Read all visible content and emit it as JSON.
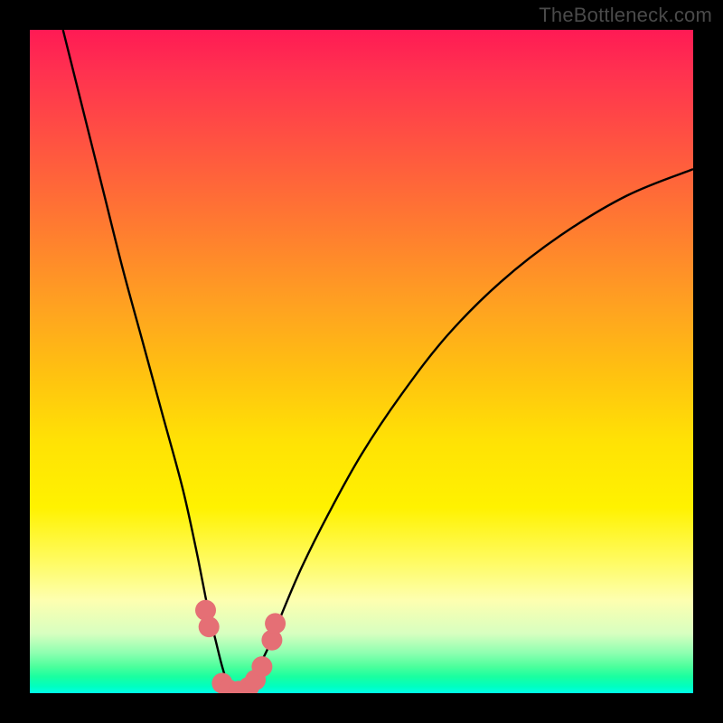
{
  "attribution": "TheBottleneck.com",
  "colors": {
    "frame": "#000000",
    "curve_stroke": "#000000",
    "marker_fill": "#e56f75",
    "marker_stroke": "#cc5a60"
  },
  "chart_data": {
    "type": "line",
    "title": "",
    "xlabel": "",
    "ylabel": "",
    "xlim": [
      0,
      100
    ],
    "ylim": [
      0,
      100
    ],
    "background_gradient": {
      "top": "#ff1a54",
      "mid": "#ffe205",
      "bottom": "#00ffe8",
      "meaning": "red-high to green-low bottleneck severity"
    },
    "series": [
      {
        "name": "bottleneck-curve",
        "x": [
          5,
          8,
          11,
          14,
          17,
          20,
          23,
          25,
          26,
          27,
          28,
          29,
          30,
          31,
          32,
          33,
          34,
          36,
          38,
          41,
          45,
          50,
          56,
          63,
          71,
          80,
          90,
          100
        ],
        "y": [
          100,
          88,
          76,
          64,
          53,
          42,
          31,
          22,
          17,
          12,
          8,
          4,
          1,
          0,
          0,
          1,
          3,
          7,
          12,
          19,
          27,
          36,
          45,
          54,
          62,
          69,
          75,
          79
        ],
        "note": "y is bottleneck percentage; minimum (~0%) near x≈31"
      }
    ],
    "markers": [
      {
        "x": 26.5,
        "y": 12.5
      },
      {
        "x": 27.0,
        "y": 10.0
      },
      {
        "x": 29.0,
        "y": 1.5
      },
      {
        "x": 30.0,
        "y": 0.5
      },
      {
        "x": 31.5,
        "y": 0.3
      },
      {
        "x": 33.0,
        "y": 0.9
      },
      {
        "x": 34.0,
        "y": 2.0
      },
      {
        "x": 35.0,
        "y": 4.0
      },
      {
        "x": 36.5,
        "y": 8.0
      },
      {
        "x": 37.0,
        "y": 10.5
      }
    ]
  }
}
